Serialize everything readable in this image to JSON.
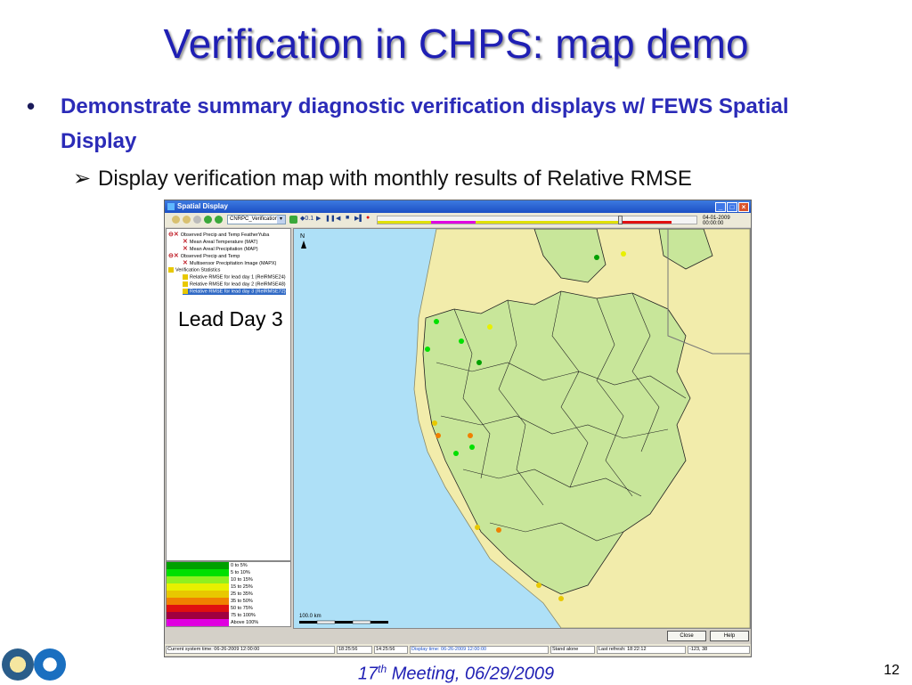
{
  "slide": {
    "title": "Verification in CHPS: map demo",
    "bullet1": "Demonstrate summary diagnostic verification displays w/ FEWS Spatial Display",
    "bullet2": "Display verification map with monthly results of Relative RMSE",
    "overlay_label": "Lead Day 3",
    "footer_num": "17",
    "footer_sup": "th",
    "footer_rest": " Meeting, 06/29/2009",
    "page_number": "12"
  },
  "window": {
    "title": "Spatial Display",
    "toolbar": {
      "workspace_select": "CNRPC_Verification",
      "speed": "0.1",
      "time": "04-01-2009 00:00:00"
    },
    "tree": [
      "Observed Precip and Temp FeatherYuba",
      "Mean Areal Temperature (MAT)",
      "Mean Areal Precipitation (MAP)",
      "Observed Precip and Temp",
      "Multisensor Precipitation Image (MAPX)",
      "Verification Statistics",
      "Relative RMSE for lead day 1 (RelRMSE24)",
      "Relative RMSE for lead day 2 (RelRMSE48)",
      "Relative RMSE for lead day 3 (RelRMSE72)"
    ],
    "legend": [
      {
        "label": "0 to 5%",
        "color": "#00a000"
      },
      {
        "label": "5 to 10%",
        "color": "#00e000"
      },
      {
        "label": "10 to 15%",
        "color": "#90f020"
      },
      {
        "label": "15 to 25%",
        "color": "#e8f000"
      },
      {
        "label": "25 to 35%",
        "color": "#e8c800"
      },
      {
        "label": "35 to 50%",
        "color": "#f08000"
      },
      {
        "label": "50 to 75%",
        "color": "#e01010"
      },
      {
        "label": "75 to 100%",
        "color": "#a00040"
      },
      {
        "label": "Above 100%",
        "color": "#e000e0"
      }
    ],
    "map": {
      "north_label": "N",
      "scale_label": "100.0 km"
    },
    "buttons": {
      "close": "Close",
      "help": "Help"
    },
    "status": {
      "current_time": "Current system time: 06-26-2009 12:00:00",
      "t1": "18:25:56",
      "t2": "14:25:56",
      "display_time": "Display time: 06-26-2009 12:00:00",
      "mode": "Stand alone",
      "last_refresh": "Last refresh: 18:22:12",
      "coords": "-123, 38"
    }
  }
}
